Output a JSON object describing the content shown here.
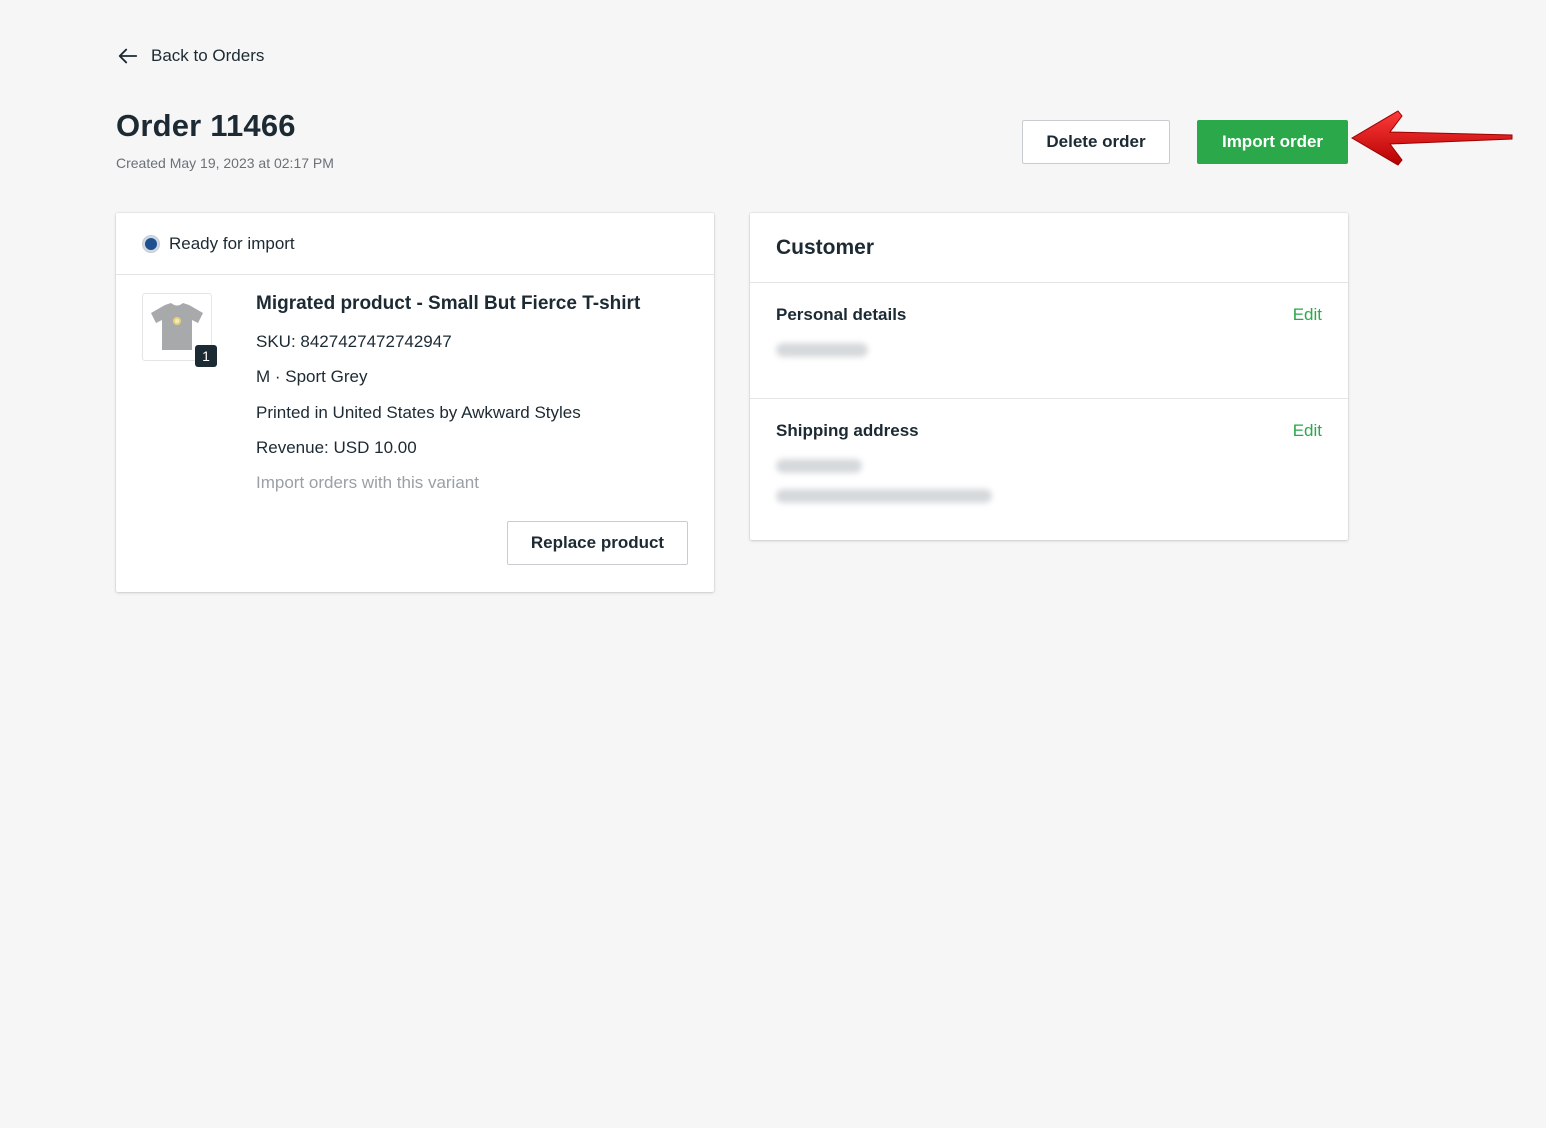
{
  "nav": {
    "back_label": "Back to Orders"
  },
  "header": {
    "title": "Order 11466",
    "created": "Created May 19, 2023 at 02:17 PM",
    "delete_label": "Delete order",
    "import_label": "Import order"
  },
  "colors": {
    "primary": "#2aa84a",
    "status_dot": "#1f4f8f",
    "annotation_arrow": "#d81515"
  },
  "order_item": {
    "status": "Ready for import",
    "quantity": "1",
    "title": "Migrated product - Small But Fierce T-shirt",
    "sku": "SKU: 8427427472742947",
    "variant": "M · Sport Grey",
    "printed_by": "Printed in United States by Awkward Styles",
    "revenue": "Revenue: USD 10.00",
    "import_variant_link": "Import orders with this variant",
    "replace_label": "Replace product",
    "thumb_icon": "tshirt-icon"
  },
  "customer": {
    "title": "Customer",
    "personal_label": "Personal details",
    "shipping_label": "Shipping address",
    "edit_label": "Edit"
  }
}
